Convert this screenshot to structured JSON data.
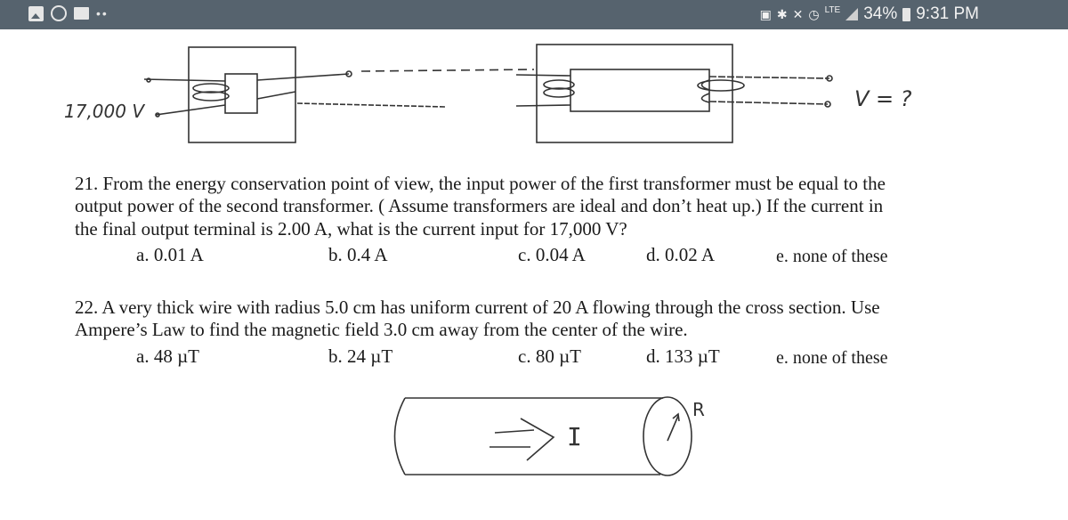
{
  "status_bar": {
    "left_icons": [
      "gallery-icon",
      "circle-app-icon",
      "message-icon",
      "more-dots-icon"
    ],
    "right_icons": [
      "battery-saver-icon",
      "bluetooth-icon",
      "vibrate-icon",
      "alarm-icon",
      "lte-icon",
      "signal-icon",
      "battery-icon"
    ],
    "network": "LTE",
    "battery_percent": "34%",
    "time": "9:31 PM"
  },
  "diagram_transformers": {
    "input_voltage_label": "17,000 V",
    "output_voltage_label": "V = ?"
  },
  "question21": {
    "lines": [
      "21. From the energy conservation point of view, the input power of the first transformer must be equal to the",
      "output power of the second transformer. ( Assume transformers are ideal and don’t heat up.) If the current in",
      "the final output terminal is 2.00 A, what is the current input for 17,000 V?"
    ],
    "choices": [
      "a. 0.01 A",
      "b. 0.4 A",
      "c. 0.04 A",
      "d. 0.02 A",
      "e. none of these"
    ]
  },
  "question22": {
    "lines": [
      "22. A very thick wire with radius 5.0 cm has uniform current of 20 A flowing through the cross section. Use",
      "Ampere’s Law to find the magnetic field 3.0 cm away from the center of the wire."
    ],
    "choices": [
      "a. 48 µT",
      "b. 24 µT",
      "c. 80 µT",
      "d. 133 µT",
      "e. none of these"
    ]
  },
  "diagram_wire": {
    "current_label": "I",
    "radius_label": "R"
  }
}
